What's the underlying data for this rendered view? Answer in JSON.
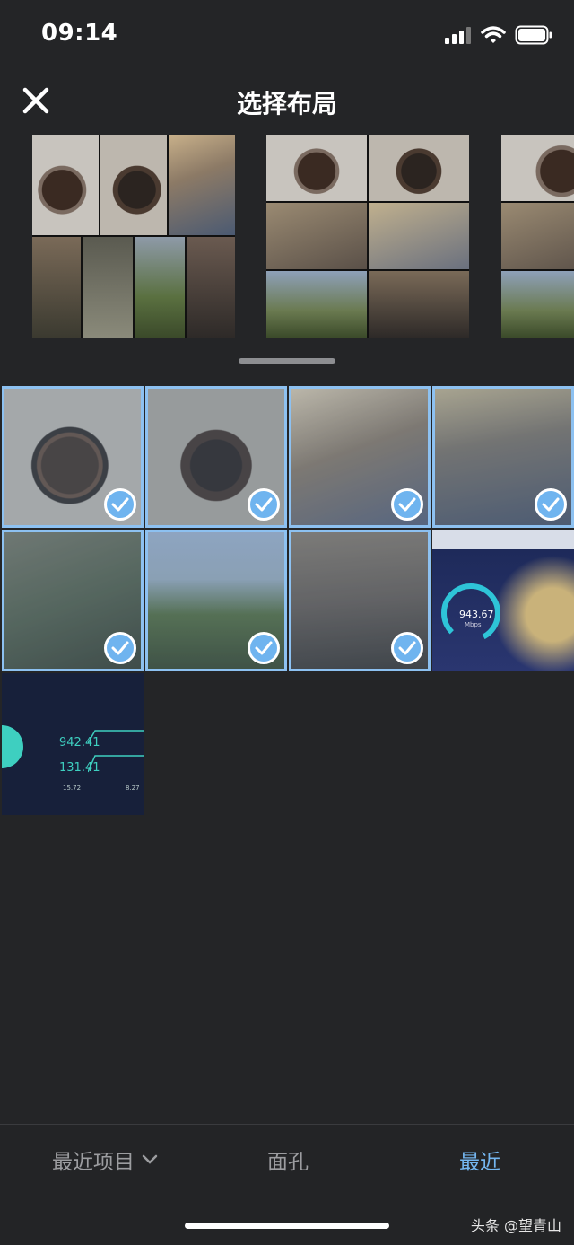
{
  "status": {
    "time": "09:14"
  },
  "header": {
    "title": "选择布局"
  },
  "grid": {
    "thumbs": [
      {
        "kind": "manhole",
        "selected": true
      },
      {
        "kind": "manhole-green",
        "selected": true
      },
      {
        "kind": "blossom",
        "selected": true
      },
      {
        "kind": "blossom-building",
        "selected": true
      },
      {
        "kind": "blossom-branch",
        "selected": true
      },
      {
        "kind": "garden",
        "selected": true
      },
      {
        "kind": "blossom-tree",
        "selected": true
      },
      {
        "kind": "speedtest-screen",
        "selected": false,
        "speed": "943.67",
        "unit": "Mbps"
      },
      {
        "kind": "speedtest-page",
        "selected": false,
        "download": "942.41",
        "upload": "131.41",
        "ping": "15.72",
        "jitter": "8.27"
      }
    ]
  },
  "tabbar": {
    "albums": "最近项目",
    "faces": "面孔",
    "recent": "最近"
  },
  "watermark": "头条 @望青山",
  "colors": {
    "background": "#242527",
    "accent": "#74b6f0",
    "selected_outline": "#8ec3f2"
  }
}
